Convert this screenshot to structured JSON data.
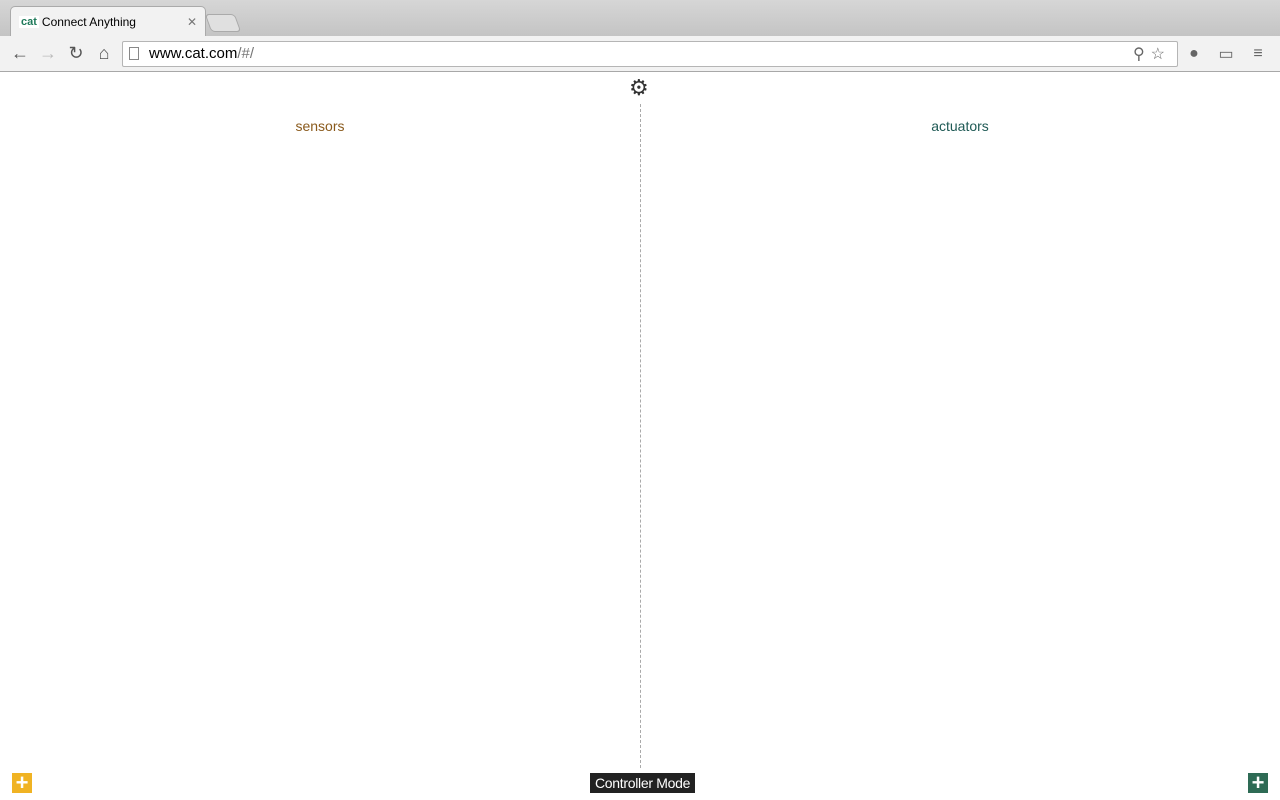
{
  "browser": {
    "tab_favicon": "cat",
    "tab_title": "Connect Anything",
    "url_host": "www.cat.com",
    "url_path": "/#/"
  },
  "app": {
    "settings_icon": "gear-icon",
    "sensors_label": "sensors",
    "actuators_label": "actuators",
    "mode_label": "Controller Mode",
    "add_sensor_color": "#f0b323",
    "add_actuator_color": "#2e6b55",
    "sensors_color": "#8a5a1c",
    "actuators_color": "#1f5a55"
  }
}
